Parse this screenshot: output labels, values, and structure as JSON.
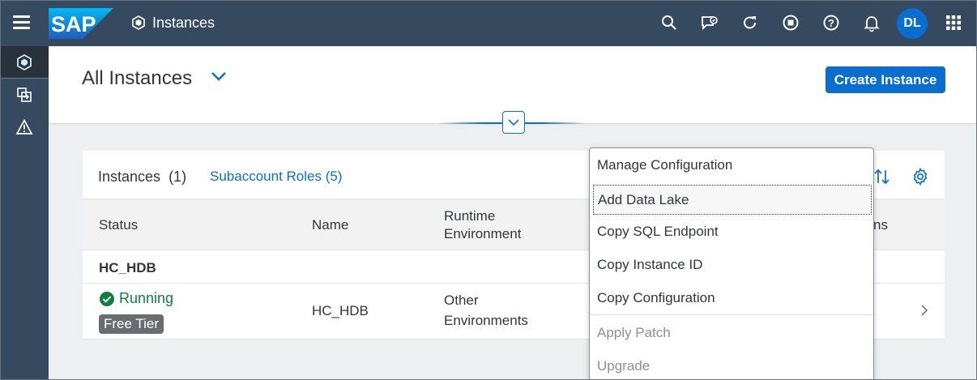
{
  "shell": {
    "app_title": "Instances",
    "logo_text": "SAP",
    "avatar_initials": "DL",
    "colors": {
      "shell_bg": "#354a5f",
      "accent": "#0a6ed1"
    }
  },
  "header_icons": [
    "search-icon",
    "feedback-icon",
    "refresh-icon",
    "stop-icon",
    "help-icon",
    "bell-icon",
    "grid-icon"
  ],
  "leftnav": [
    "instances-icon",
    "import-icon",
    "alert-icon"
  ],
  "page": {
    "title": "All Instances",
    "create_button": "Create Instance"
  },
  "table": {
    "title": "Instances",
    "count": "(1)",
    "roles_link": "Subaccount Roles (5)",
    "columns": {
      "status": "Status",
      "name": "Name",
      "runtime_line1": "Runtime",
      "runtime_line2": "Environment",
      "actions_fragment": "ns"
    },
    "group": "HC_HDB",
    "row": {
      "status": "Running",
      "tier": "Free Tier",
      "name": "HC_HDB",
      "runtime_line1": "Other",
      "runtime_line2": "Environments"
    }
  },
  "menu": {
    "items": [
      {
        "label": "Manage Configuration",
        "enabled": true
      },
      {
        "label": "Add Data Lake",
        "enabled": true
      },
      {
        "label": "Copy SQL Endpoint",
        "enabled": true
      },
      {
        "label": "Copy Instance ID",
        "enabled": true
      },
      {
        "label": "Copy Configuration",
        "enabled": true
      },
      {
        "label": "Apply Patch",
        "enabled": false
      },
      {
        "label": "Upgrade",
        "enabled": false
      }
    ]
  }
}
